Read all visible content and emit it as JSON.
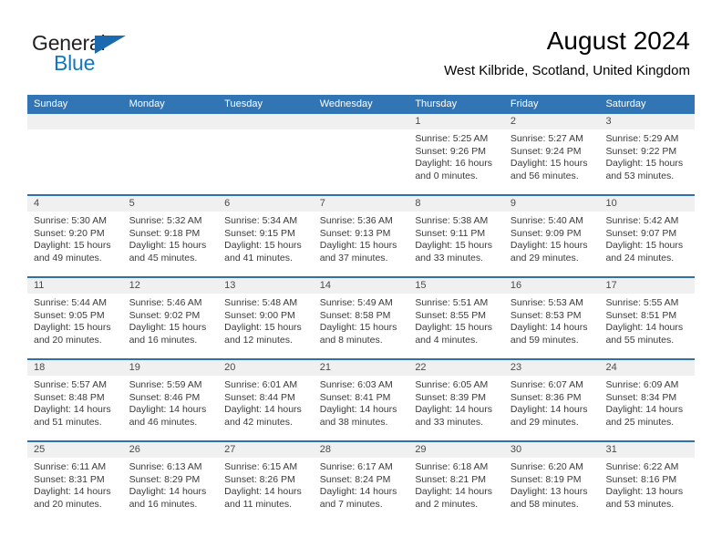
{
  "brand": {
    "name_part1": "General",
    "name_part2": "Blue",
    "flag_icon": "blue-triangle-flag-icon",
    "color_dark": "#231f20",
    "color_blue": "#1278be"
  },
  "header": {
    "title": "August 2024",
    "subtitle": "West Kilbride, Scotland, United Kingdom",
    "accent_color": "#3275b5",
    "daynum_band_color": "#f0f0f0",
    "row_divider_color": "#2e6fad"
  },
  "weekday_headers": [
    "Sunday",
    "Monday",
    "Tuesday",
    "Wednesday",
    "Thursday",
    "Friday",
    "Saturday"
  ],
  "weeks": [
    [
      {
        "day": "",
        "empty": true,
        "lines": []
      },
      {
        "day": "",
        "empty": true,
        "lines": []
      },
      {
        "day": "",
        "empty": true,
        "lines": []
      },
      {
        "day": "",
        "empty": true,
        "lines": []
      },
      {
        "day": "1",
        "empty": false,
        "lines": [
          "Sunrise: 5:25 AM",
          "Sunset: 9:26 PM",
          "Daylight: 16 hours",
          "and 0 minutes."
        ]
      },
      {
        "day": "2",
        "empty": false,
        "lines": [
          "Sunrise: 5:27 AM",
          "Sunset: 9:24 PM",
          "Daylight: 15 hours",
          "and 56 minutes."
        ]
      },
      {
        "day": "3",
        "empty": false,
        "lines": [
          "Sunrise: 5:29 AM",
          "Sunset: 9:22 PM",
          "Daylight: 15 hours",
          "and 53 minutes."
        ]
      }
    ],
    [
      {
        "day": "4",
        "empty": false,
        "lines": [
          "Sunrise: 5:30 AM",
          "Sunset: 9:20 PM",
          "Daylight: 15 hours",
          "and 49 minutes."
        ]
      },
      {
        "day": "5",
        "empty": false,
        "lines": [
          "Sunrise: 5:32 AM",
          "Sunset: 9:18 PM",
          "Daylight: 15 hours",
          "and 45 minutes."
        ]
      },
      {
        "day": "6",
        "empty": false,
        "lines": [
          "Sunrise: 5:34 AM",
          "Sunset: 9:15 PM",
          "Daylight: 15 hours",
          "and 41 minutes."
        ]
      },
      {
        "day": "7",
        "empty": false,
        "lines": [
          "Sunrise: 5:36 AM",
          "Sunset: 9:13 PM",
          "Daylight: 15 hours",
          "and 37 minutes."
        ]
      },
      {
        "day": "8",
        "empty": false,
        "lines": [
          "Sunrise: 5:38 AM",
          "Sunset: 9:11 PM",
          "Daylight: 15 hours",
          "and 33 minutes."
        ]
      },
      {
        "day": "9",
        "empty": false,
        "lines": [
          "Sunrise: 5:40 AM",
          "Sunset: 9:09 PM",
          "Daylight: 15 hours",
          "and 29 minutes."
        ]
      },
      {
        "day": "10",
        "empty": false,
        "lines": [
          "Sunrise: 5:42 AM",
          "Sunset: 9:07 PM",
          "Daylight: 15 hours",
          "and 24 minutes."
        ]
      }
    ],
    [
      {
        "day": "11",
        "empty": false,
        "lines": [
          "Sunrise: 5:44 AM",
          "Sunset: 9:05 PM",
          "Daylight: 15 hours",
          "and 20 minutes."
        ]
      },
      {
        "day": "12",
        "empty": false,
        "lines": [
          "Sunrise: 5:46 AM",
          "Sunset: 9:02 PM",
          "Daylight: 15 hours",
          "and 16 minutes."
        ]
      },
      {
        "day": "13",
        "empty": false,
        "lines": [
          "Sunrise: 5:48 AM",
          "Sunset: 9:00 PM",
          "Daylight: 15 hours",
          "and 12 minutes."
        ]
      },
      {
        "day": "14",
        "empty": false,
        "lines": [
          "Sunrise: 5:49 AM",
          "Sunset: 8:58 PM",
          "Daylight: 15 hours",
          "and 8 minutes."
        ]
      },
      {
        "day": "15",
        "empty": false,
        "lines": [
          "Sunrise: 5:51 AM",
          "Sunset: 8:55 PM",
          "Daylight: 15 hours",
          "and 4 minutes."
        ]
      },
      {
        "day": "16",
        "empty": false,
        "lines": [
          "Sunrise: 5:53 AM",
          "Sunset: 8:53 PM",
          "Daylight: 14 hours",
          "and 59 minutes."
        ]
      },
      {
        "day": "17",
        "empty": false,
        "lines": [
          "Sunrise: 5:55 AM",
          "Sunset: 8:51 PM",
          "Daylight: 14 hours",
          "and 55 minutes."
        ]
      }
    ],
    [
      {
        "day": "18",
        "empty": false,
        "lines": [
          "Sunrise: 5:57 AM",
          "Sunset: 8:48 PM",
          "Daylight: 14 hours",
          "and 51 minutes."
        ]
      },
      {
        "day": "19",
        "empty": false,
        "lines": [
          "Sunrise: 5:59 AM",
          "Sunset: 8:46 PM",
          "Daylight: 14 hours",
          "and 46 minutes."
        ]
      },
      {
        "day": "20",
        "empty": false,
        "lines": [
          "Sunrise: 6:01 AM",
          "Sunset: 8:44 PM",
          "Daylight: 14 hours",
          "and 42 minutes."
        ]
      },
      {
        "day": "21",
        "empty": false,
        "lines": [
          "Sunrise: 6:03 AM",
          "Sunset: 8:41 PM",
          "Daylight: 14 hours",
          "and 38 minutes."
        ]
      },
      {
        "day": "22",
        "empty": false,
        "lines": [
          "Sunrise: 6:05 AM",
          "Sunset: 8:39 PM",
          "Daylight: 14 hours",
          "and 33 minutes."
        ]
      },
      {
        "day": "23",
        "empty": false,
        "lines": [
          "Sunrise: 6:07 AM",
          "Sunset: 8:36 PM",
          "Daylight: 14 hours",
          "and 29 minutes."
        ]
      },
      {
        "day": "24",
        "empty": false,
        "lines": [
          "Sunrise: 6:09 AM",
          "Sunset: 8:34 PM",
          "Daylight: 14 hours",
          "and 25 minutes."
        ]
      }
    ],
    [
      {
        "day": "25",
        "empty": false,
        "lines": [
          "Sunrise: 6:11 AM",
          "Sunset: 8:31 PM",
          "Daylight: 14 hours",
          "and 20 minutes."
        ]
      },
      {
        "day": "26",
        "empty": false,
        "lines": [
          "Sunrise: 6:13 AM",
          "Sunset: 8:29 PM",
          "Daylight: 14 hours",
          "and 16 minutes."
        ]
      },
      {
        "day": "27",
        "empty": false,
        "lines": [
          "Sunrise: 6:15 AM",
          "Sunset: 8:26 PM",
          "Daylight: 14 hours",
          "and 11 minutes."
        ]
      },
      {
        "day": "28",
        "empty": false,
        "lines": [
          "Sunrise: 6:17 AM",
          "Sunset: 8:24 PM",
          "Daylight: 14 hours",
          "and 7 minutes."
        ]
      },
      {
        "day": "29",
        "empty": false,
        "lines": [
          "Sunrise: 6:18 AM",
          "Sunset: 8:21 PM",
          "Daylight: 14 hours",
          "and 2 minutes."
        ]
      },
      {
        "day": "30",
        "empty": false,
        "lines": [
          "Sunrise: 6:20 AM",
          "Sunset: 8:19 PM",
          "Daylight: 13 hours",
          "and 58 minutes."
        ]
      },
      {
        "day": "31",
        "empty": false,
        "lines": [
          "Sunrise: 6:22 AM",
          "Sunset: 8:16 PM",
          "Daylight: 13 hours",
          "and 53 minutes."
        ]
      }
    ]
  ]
}
